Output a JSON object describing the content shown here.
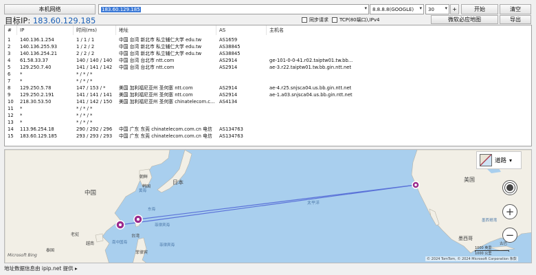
{
  "toolbar": {
    "local_net_label": "本机网络",
    "target_value": "183.60.129.185",
    "dns_value": "8.8.8.8(GOOGLE)",
    "count_value": "30",
    "plus_label": "+",
    "start_label": "开始",
    "clear_label": "清空",
    "sync_label": "同步请求",
    "tcp_label": "TCP(80端口),IPv4",
    "map_button_label": "微软必应地图",
    "export_label": "导出"
  },
  "target": {
    "prefix": "目标IP:",
    "ip": "183.60.129.185"
  },
  "table": {
    "headers": [
      "#",
      "IP",
      "时间(ms)",
      "地址",
      "AS",
      "主机名"
    ],
    "rows": [
      {
        "n": "1",
        "ip": "140.136.1.254",
        "time": "1 / 1 / 1",
        "addr": "中国 台湾 新北市 私立辅仁大学 edu.tw",
        "as": "AS1659",
        "host": ""
      },
      {
        "n": "2",
        "ip": "140.136.255.93",
        "time": "1 / 2 / 2",
        "addr": "中国 台湾 新北市 私立辅仁大学 edu.tw",
        "as": "AS38845",
        "host": ""
      },
      {
        "n": "3",
        "ip": "140.136.254.21",
        "time": "2 / 2 / 2",
        "addr": "中国 台湾 新北市 私立辅仁大学 edu.tw",
        "as": "AS38845",
        "host": ""
      },
      {
        "n": "4",
        "ip": "61.58.33.37",
        "time": "140 / 140 / 140",
        "addr": "中国 台湾 台北市 ntt.com",
        "as": "AS2914",
        "host": "ge-101-0-0-41.r02.taiptw01.tw.bb..."
      },
      {
        "n": "5",
        "ip": "129.250.7.40",
        "time": "141 / 141 / 142",
        "addr": "中国 台湾 台北市 ntt.com",
        "as": "AS2914",
        "host": "ae-3.r22.taiptw01.tw.bb.gin.ntt.net"
      },
      {
        "n": "6",
        "ip": "*",
        "time": "* / * / *",
        "addr": "",
        "as": "",
        "host": ""
      },
      {
        "n": "7",
        "ip": "*",
        "time": "* / * / *",
        "addr": "",
        "as": "",
        "host": ""
      },
      {
        "n": "8",
        "ip": "129.250.5.78",
        "time": "147 / 153 / *",
        "addr": "美国 加利福尼亚州 圣何塞 ntt.com",
        "as": "AS2914",
        "host": "ae-4.r25.snjsca04.us.bb.gin.ntt.net"
      },
      {
        "n": "9",
        "ip": "129.250.2.191",
        "time": "141 / 141 / 141",
        "addr": "美国 加利福尼亚州 圣何塞 ntt.com",
        "as": "AS2914",
        "host": "ae-1.a03.snjsca04.us.bb.gin.ntt.net"
      },
      {
        "n": "10",
        "ip": "218.30.53.50",
        "time": "141 / 142 / 150",
        "addr": "美国 加利福尼亚州 圣何塞 chinatelecom.c...",
        "as": "AS4134",
        "host": ""
      },
      {
        "n": "11",
        "ip": "*",
        "time": "* / * / *",
        "addr": "",
        "as": "",
        "host": ""
      },
      {
        "n": "12",
        "ip": "*",
        "time": "* / * / *",
        "addr": "",
        "as": "",
        "host": ""
      },
      {
        "n": "13",
        "ip": "*",
        "time": "* / * / *",
        "addr": "",
        "as": "",
        "host": ""
      },
      {
        "n": "14",
        "ip": "113.96.254.18",
        "time": "290 / 292 / 296",
        "addr": "中国 广东 东莞 chinatelecom.com.cn 电信",
        "as": "AS134763",
        "host": ""
      },
      {
        "n": "15",
        "ip": "183.60.129.185",
        "time": "293 / 293 / 293",
        "addr": "中国 广东 东莞 chinatelecom.com.cn 电信",
        "as": "AS134763",
        "host": ""
      }
    ]
  },
  "map": {
    "style_label": "道路",
    "labels": {
      "china": "中国",
      "japan": "日本",
      "korea": "韩国",
      "north_korea": "朝鲜",
      "usa": "美国",
      "mexico": "墨西哥",
      "pacific": "太平洋",
      "ph_sea": "菲律宾海",
      "south_china_sea": "南中国海",
      "yellow_sea": "黄海",
      "east_china_sea": "东海",
      "taiwan": "台湾",
      "philippines": "菲律宾",
      "vietnam": "越南",
      "laos": "老挝",
      "thailand": "泰国",
      "gulf_mexico": "墨西哥湾",
      "cuba": "古巴"
    },
    "scale_label": "1000 英里",
    "scale_label_km": "1000 公里",
    "bing_label": "Microsoft Bing",
    "copyright": "© 2024 TomTom, © 2024 Microsoft Corporation  条款"
  },
  "footer": {
    "source_text": "地址数据信息由 ipip.net 提供 ▸"
  },
  "colors": {
    "accent": "#1a5fb4",
    "route": "#5a72d8",
    "marker": "#9b2a8c",
    "water": "#a9cfee",
    "land": "#f2efe6"
  }
}
